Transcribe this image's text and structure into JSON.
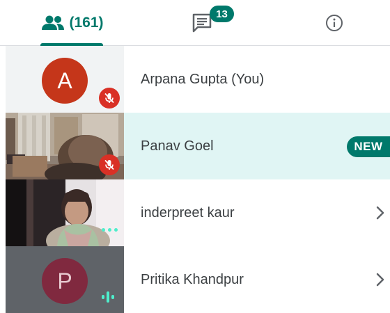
{
  "tabs": {
    "people_count": "(161)",
    "chat_badge": "13"
  },
  "participants": [
    {
      "name": "Arpana Gupta (You)",
      "avatar_letter": "A",
      "avatar_color": "#c5361a",
      "tile_bg": "#f1f3f4",
      "muted": true
    },
    {
      "name": "Panav Goel",
      "badge": "NEW",
      "tile_type": "video-room",
      "muted": true,
      "highlighted": true
    },
    {
      "name": "inderpreet kaur",
      "tile_type": "video-person",
      "status": "dots"
    },
    {
      "name": "Pritika Khandpur",
      "avatar_letter": "P",
      "avatar_color": "#80293f",
      "tile_bg": "#5f6368",
      "status": "speaking"
    }
  ],
  "colors": {
    "accent": "#00796b",
    "highlight_row": "#e0f5f4",
    "mute_red": "#d93025",
    "speaking_teal": "#4eeecc"
  }
}
